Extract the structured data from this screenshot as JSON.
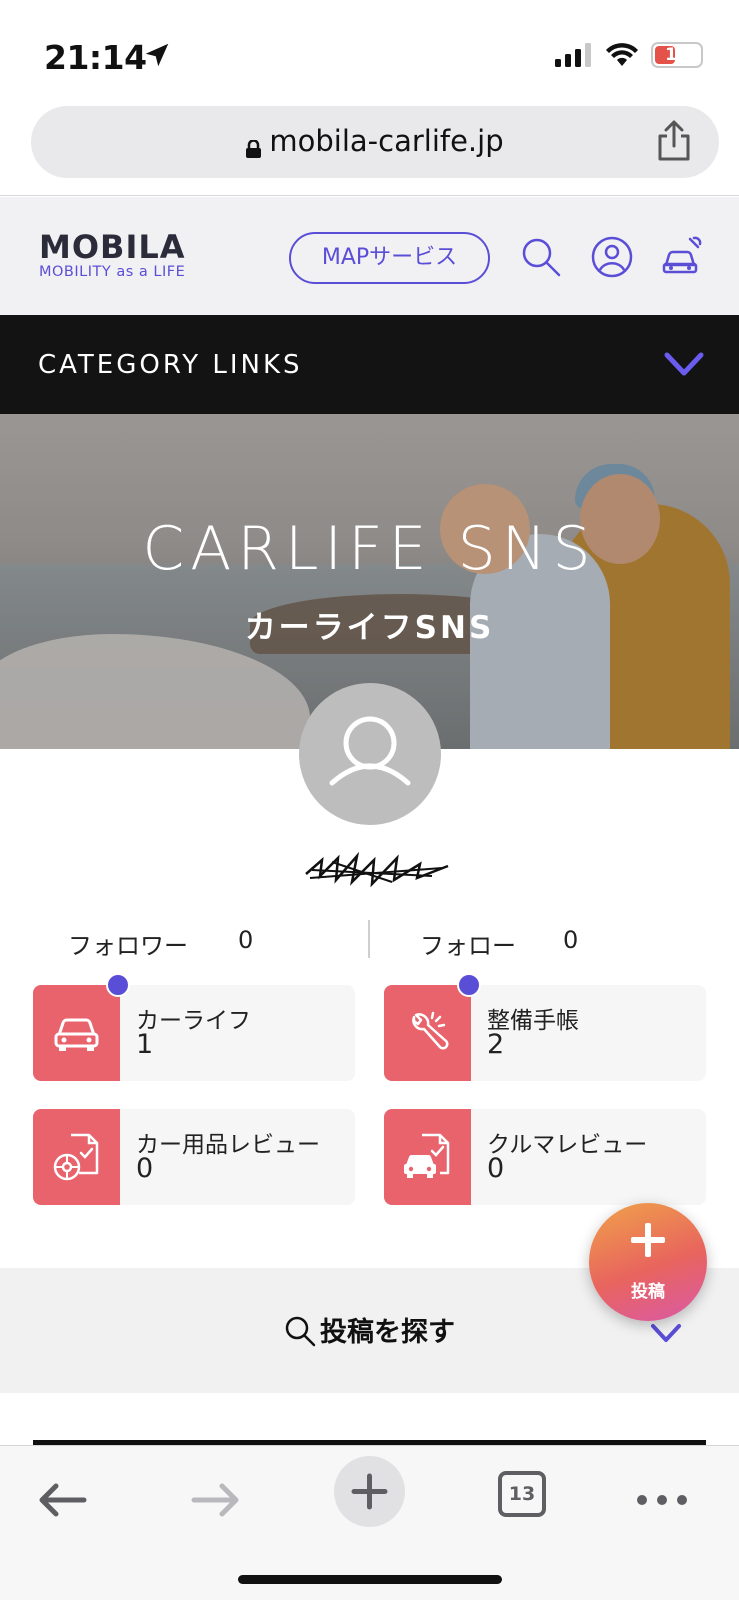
{
  "status_bar": {
    "time": "21:14",
    "battery": "14"
  },
  "browser": {
    "url": "mobila-carlife.jp",
    "tab_count": "13"
  },
  "site_header": {
    "logo_main": "MOBILA",
    "logo_sub": "MOBILITY as a LIFE",
    "map_button": "MAPサービス"
  },
  "category_bar": {
    "label": "CATEGORY LINKS"
  },
  "hero": {
    "title": "CARLIFE SNS",
    "subtitle": "カーライフSNS"
  },
  "profile": {
    "followers_label": "フォロワー",
    "followers_count": "0",
    "following_label": "フォロー",
    "following_count": "0"
  },
  "cards": [
    {
      "title": "カーライフ",
      "value": "1",
      "icon": "car-icon",
      "has_dot": true
    },
    {
      "title": "整備手帳",
      "value": "2",
      "icon": "wrench-icon",
      "has_dot": true
    },
    {
      "title": "カー用品レビュー",
      "value": "0",
      "icon": "tire-document-icon",
      "has_dot": false
    },
    {
      "title": "クルマレビュー",
      "value": "0",
      "icon": "car-document-icon",
      "has_dot": false
    }
  ],
  "search_posts": {
    "label": "投稿を探す"
  },
  "fab": {
    "label": "投稿"
  },
  "colors": {
    "accent": "#5b4ed6",
    "card_icon_bg": "#e8636c",
    "category_bar_bg": "#131314"
  }
}
